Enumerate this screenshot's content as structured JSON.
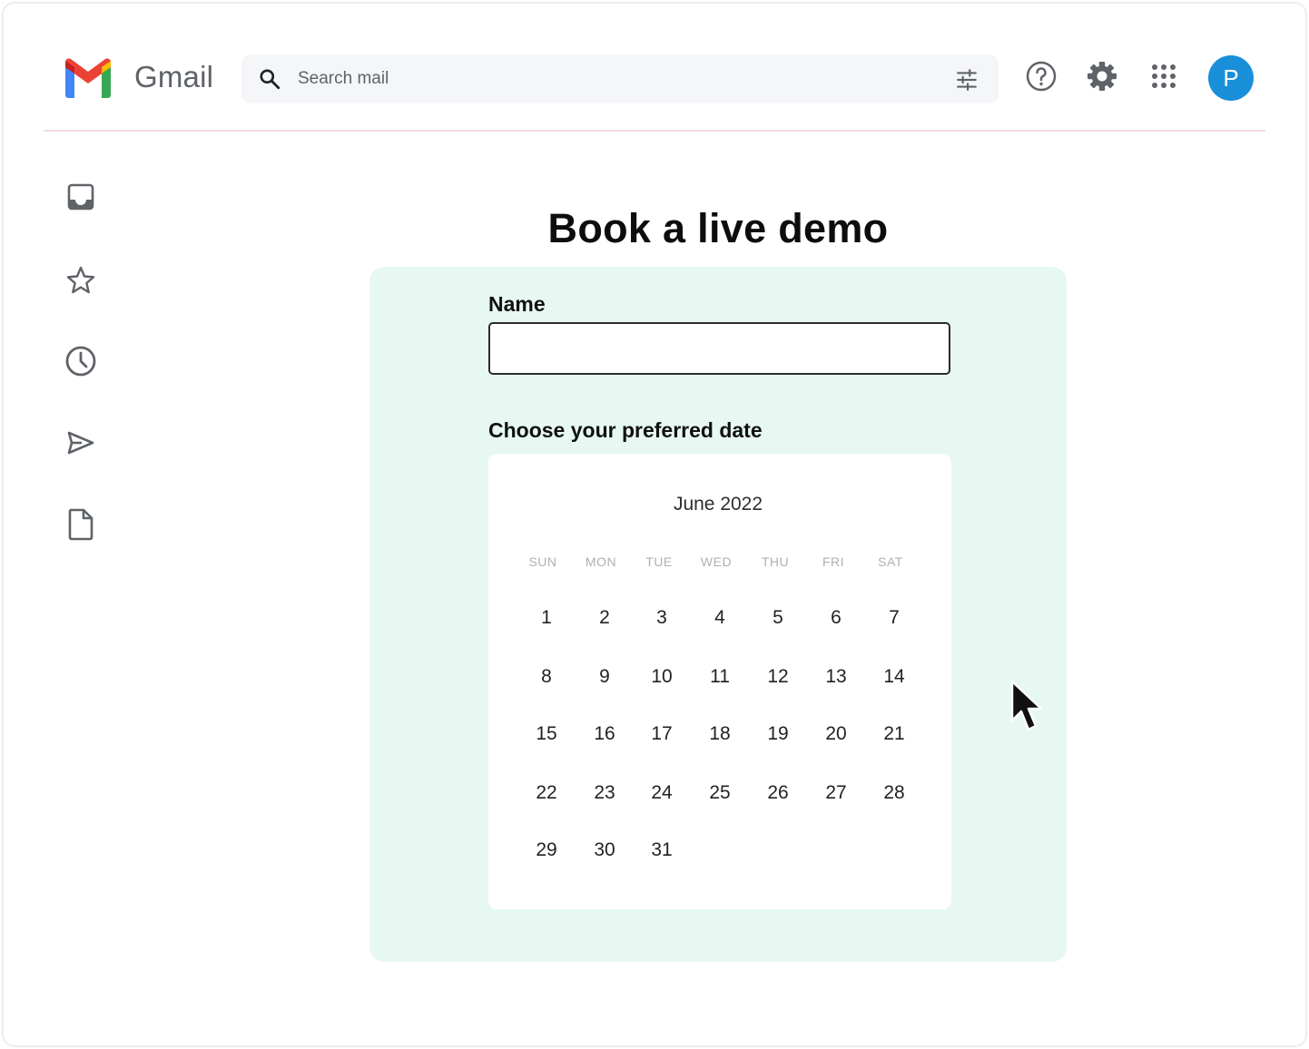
{
  "header": {
    "app_name": "Gmail",
    "search_placeholder": "Search mail",
    "avatar_initial": "P",
    "brand_colors": {
      "red": "#ea4335",
      "blue": "#4285f4",
      "green": "#34a853",
      "yellow": "#fbbc04",
      "avatar": "#1a8fd9"
    }
  },
  "sidebar": {
    "items": [
      {
        "icon": "inbox-icon"
      },
      {
        "icon": "star-icon"
      },
      {
        "icon": "clock-icon"
      },
      {
        "icon": "send-icon"
      },
      {
        "icon": "document-icon"
      }
    ]
  },
  "form": {
    "title": "Book a live demo",
    "name_label": "Name",
    "name_value": "",
    "date_label": "Choose your preferred date",
    "card_color": "#e7f8f2"
  },
  "calendar": {
    "month": "June 2022",
    "weekdays": [
      "SUN",
      "MON",
      "TUE",
      "WED",
      "THU",
      "FRI",
      "SAT"
    ],
    "weeks": [
      [
        "1",
        "2",
        "3",
        "4",
        "5",
        "6",
        "7"
      ],
      [
        "8",
        "9",
        "10",
        "11",
        "12",
        "13",
        "14"
      ],
      [
        "15",
        "16",
        "17",
        "18",
        "19",
        "20",
        "21"
      ],
      [
        "22",
        "23",
        "24",
        "25",
        "26",
        "27",
        "28"
      ],
      [
        "29",
        "30",
        "31"
      ]
    ]
  }
}
